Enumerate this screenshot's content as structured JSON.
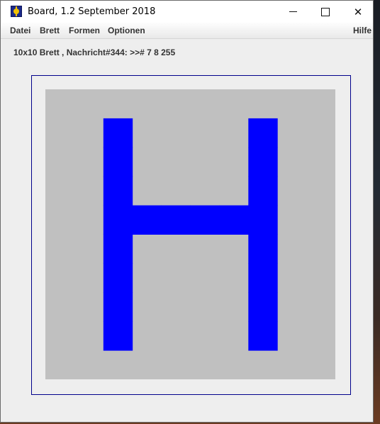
{
  "window": {
    "title": "Board, 1.2 September 2018",
    "icon": "app-icon",
    "controls": {
      "minimize": "minimize-icon",
      "maximize": "maximize-icon",
      "close": "✕"
    }
  },
  "menu": {
    "items": [
      "Datei",
      "Brett",
      "Formen",
      "Optionen"
    ],
    "help": "Hilfe"
  },
  "status": {
    "message": "10x10 Brett , Nachricht#344: >># 7 8 255"
  },
  "board": {
    "rows": 10,
    "cols": 10,
    "background_color": "#c0c0c0",
    "cell_color": "#0000ff",
    "filled_cells": [
      [
        1,
        2
      ],
      [
        1,
        7
      ],
      [
        2,
        2
      ],
      [
        2,
        7
      ],
      [
        3,
        2
      ],
      [
        3,
        7
      ],
      [
        4,
        2
      ],
      [
        4,
        3
      ],
      [
        4,
        4
      ],
      [
        4,
        5
      ],
      [
        4,
        6
      ],
      [
        4,
        7
      ],
      [
        5,
        2
      ],
      [
        5,
        7
      ],
      [
        6,
        2
      ],
      [
        6,
        7
      ],
      [
        7,
        2
      ],
      [
        7,
        7
      ],
      [
        8,
        2
      ],
      [
        8,
        7
      ]
    ]
  }
}
